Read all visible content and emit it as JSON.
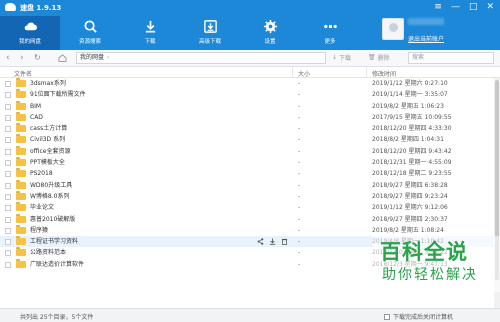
{
  "app": {
    "title": "速盘 1.9.13"
  },
  "window_controls": [
    "≡",
    "—",
    "□",
    "✕"
  ],
  "nav": [
    {
      "label": "我的网盘",
      "icon": "cloud-icon",
      "active": true
    },
    {
      "label": "资源搜索",
      "icon": "search-icon",
      "active": false
    },
    {
      "label": "下载",
      "icon": "download-icon",
      "active": false
    },
    {
      "label": "高级下载",
      "icon": "advanced-download-icon",
      "active": false
    },
    {
      "label": "设置",
      "icon": "gear-icon",
      "active": false
    },
    {
      "label": "更多",
      "icon": "more-icon",
      "active": false
    }
  ],
  "account": {
    "logout_label": "退出当前账户"
  },
  "pathbar": {
    "path": "我的网盘",
    "download_label": "下载",
    "delete_label": "删除",
    "search_placeholder": "搜索"
  },
  "columns": {
    "name": "文件名",
    "size": "大小",
    "date": "修改时间"
  },
  "rows": [
    {
      "name": "3dsmax系列",
      "size": "-",
      "date": "2019/1/12 星期六 0:27:10"
    },
    {
      "name": "91位面下载所需文件",
      "size": "-",
      "date": "2019/1/14 星期一 3:35:07"
    },
    {
      "name": "BIM",
      "size": "-",
      "date": "2019/8/2 星期五 1:06:23"
    },
    {
      "name": "CAD",
      "size": "-",
      "date": "2017/9/15 星期五 10:09:55"
    },
    {
      "name": "cass土方计算",
      "size": "-",
      "date": "2018/12/20 星期四 4:33:30"
    },
    {
      "name": "Civil3D 系列",
      "size": "-",
      "date": "2018/8/2 星期四 1:04:31"
    },
    {
      "name": "office全套资源",
      "size": "-",
      "date": "2018/12/20 星期四 9:43:42"
    },
    {
      "name": "PPT模板大全",
      "size": "-",
      "date": "2018/12/31 星期一 4:55:09"
    },
    {
      "name": "PS2018",
      "size": "-",
      "date": "2018/12/18 星期二 9:23:55"
    },
    {
      "name": "WD80升级工具",
      "size": "-",
      "date": "2018/9/27 星期四 6:38:28"
    },
    {
      "name": "W博格8.0系列",
      "size": "-",
      "date": "2018/9/27 星期四 9:23:24"
    },
    {
      "name": "毕业论文",
      "size": "-",
      "date": "2019/1/12 星期六 9:12:06"
    },
    {
      "name": "惠普2010破解版",
      "size": "-",
      "date": "2018/9/27 星期四 2:30:37"
    },
    {
      "name": "程序猿",
      "size": "-",
      "date": "2019/8/2 星期五 1:08:24"
    },
    {
      "name": "工程证书学习资料",
      "size": "-",
      "date": "2019/4/8 星期一 1:10:42"
    },
    {
      "name": "公路资料范本",
      "size": "-",
      "date": "2018/7/10 星期二 3:57:22"
    },
    {
      "name": "广联达造价计算软件",
      "size": "-",
      "date": "2018/12/3 星期一 9:47:13"
    }
  ],
  "hover_row_index": 14,
  "status": {
    "summary": "共列出 25个目录，5个文件",
    "shutdown_label": "下载完成后关闭计算机"
  },
  "watermark": {
    "main": "百科全说",
    "sub": "助你轻松解决"
  },
  "colors": {
    "titlebar": "#1e88d8",
    "active_nav": "#1366b4",
    "folder": "#f6c244",
    "watermark": "#2aa44b"
  }
}
